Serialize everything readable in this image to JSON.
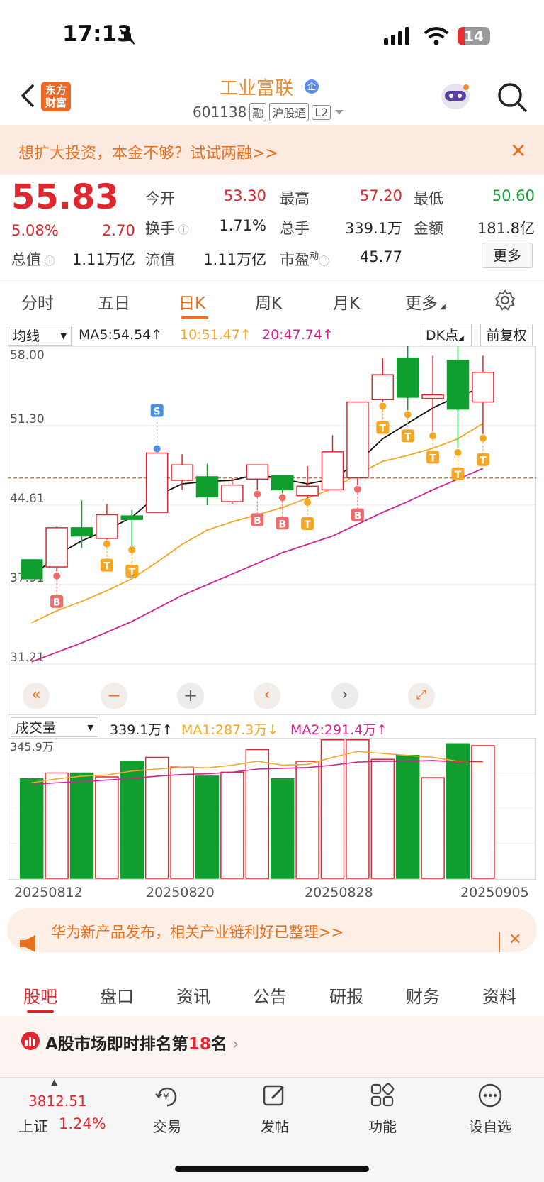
{
  "status_bar": {
    "time": "17:13",
    "battery": "14"
  },
  "header": {
    "logo_line1": "东方",
    "logo_line2": "财富",
    "stock_name": "工业富联",
    "name_badge": "企",
    "stock_code": "601138",
    "tags": [
      "融",
      "沪股通",
      "L2"
    ]
  },
  "promo": {
    "text": "想扩大投资，本金不够？试试两融>>"
  },
  "quote": {
    "price": "55.83",
    "change_pct": "5.08%",
    "change": "2.70",
    "market_cap_label": "总值",
    "market_cap": "1.11万亿",
    "rows": [
      [
        {
          "l": "今开",
          "v": "53.30",
          "c": "red"
        },
        {
          "l": "最高",
          "v": "57.20",
          "c": "red"
        },
        {
          "l": "最低",
          "v": "50.60",
          "c": "green"
        }
      ],
      [
        {
          "l": "换手",
          "v": "1.71%",
          "c": "dark"
        },
        {
          "l": "总手",
          "v": "339.1万",
          "c": "dark"
        },
        {
          "l": "金额",
          "v": "181.8亿",
          "c": "dark"
        }
      ],
      [
        {
          "l": "流值",
          "v": "1.11万亿",
          "c": "dark"
        },
        {
          "l": "市盈",
          "v": "45.77",
          "c": "dark"
        }
      ]
    ],
    "pe_sup": "动",
    "more": "更多"
  },
  "period_tabs": [
    "分时",
    "五日",
    "日K",
    "周K",
    "月K",
    "更多"
  ],
  "active_period": "日K",
  "chart_header": {
    "indicator": "均线",
    "ma5": "MA5:54.54↑",
    "ma10": "10:51.47↑",
    "ma20": "20:47.74↑",
    "dk": "DK点",
    "adjust": "前复权"
  },
  "colors": {
    "up": "#e0272f",
    "down": "#109f2f",
    "ma5": "#111111",
    "ma10": "#f5a623",
    "ma20": "#d6208f",
    "accent": "#e8701f"
  },
  "chart_data": {
    "type": "candlestick",
    "y_ticks": [
      "58.00",
      "51.30",
      "44.61",
      "37.91",
      "31.21"
    ],
    "ylim": [
      31.21,
      58.0
    ],
    "x_labels": [
      "20250812",
      "20250820",
      "20250828",
      "20250905"
    ],
    "candles": [
      {
        "o": 40.0,
        "c": 38.4,
        "h": 40.0,
        "l": 38.4,
        "up": false
      },
      {
        "o": 39.4,
        "c": 42.7,
        "h": 42.8,
        "l": 39.0,
        "up": true
      },
      {
        "o": 42.7,
        "c": 42.0,
        "h": 45.0,
        "l": 41.0,
        "up": false
      },
      {
        "o": 41.8,
        "c": 43.8,
        "h": 44.7,
        "l": 41.7,
        "up": true
      },
      {
        "o": 43.7,
        "c": 43.4,
        "h": 44.2,
        "l": 41.2,
        "up": false
      },
      {
        "o": 44.0,
        "c": 49.0,
        "h": 49.0,
        "l": 44.0,
        "up": true
      },
      {
        "o": 46.7,
        "c": 48.0,
        "h": 48.9,
        "l": 45.9,
        "up": true
      },
      {
        "o": 47.0,
        "c": 45.3,
        "h": 48.1,
        "l": 44.6,
        "up": false
      },
      {
        "o": 44.9,
        "c": 46.3,
        "h": 46.9,
        "l": 44.7,
        "up": true
      },
      {
        "o": 46.8,
        "c": 48.0,
        "h": 48.0,
        "l": 45.9,
        "up": true
      },
      {
        "o": 47.1,
        "c": 45.9,
        "h": 47.1,
        "l": 45.6,
        "up": false
      },
      {
        "o": 45.4,
        "c": 46.2,
        "h": 47.9,
        "l": 45.2,
        "up": true
      },
      {
        "o": 45.9,
        "c": 49.1,
        "h": 50.5,
        "l": 45.9,
        "up": true
      },
      {
        "o": 46.9,
        "c": 53.3,
        "h": 53.3,
        "l": 46.3,
        "up": true
      },
      {
        "o": 53.5,
        "c": 55.6,
        "h": 57.0,
        "l": 53.3,
        "up": true
      },
      {
        "o": 57.0,
        "c": 53.7,
        "h": 58.4,
        "l": 52.6,
        "up": false
      },
      {
        "o": 53.6,
        "c": 53.9,
        "h": 57.2,
        "l": 50.8,
        "up": true
      },
      {
        "o": 56.8,
        "c": 52.7,
        "h": 58.5,
        "l": 49.4,
        "up": false
      },
      {
        "o": 53.3,
        "c": 55.8,
        "h": 57.2,
        "l": 50.6,
        "up": true
      }
    ],
    "ma5": [
      38.5,
      40.4,
      41.6,
      42.5,
      43.6,
      45.4,
      46.4,
      46.6,
      46.7,
      47.2,
      46.8,
      46.4,
      46.8,
      48.2,
      50.2,
      51.5,
      52.8,
      53.8,
      54.5
    ],
    "ma10": [
      34.7,
      35.7,
      36.5,
      37.4,
      38.4,
      39.8,
      41.3,
      42.5,
      43.2,
      43.8,
      44.4,
      45.2,
      46.0,
      47.2,
      48.3,
      48.8,
      49.4,
      50.2,
      51.5
    ],
    "ma20": [
      31.4,
      32.2,
      33.0,
      33.9,
      34.8,
      35.9,
      37.0,
      37.9,
      38.8,
      39.7,
      40.6,
      41.3,
      42.0,
      43.0,
      44.0,
      44.9,
      45.9,
      46.8,
      47.7
    ],
    "signals": [
      {
        "i": 1,
        "t": "B"
      },
      {
        "i": 3,
        "t": "T"
      },
      {
        "i": 4,
        "t": "T"
      },
      {
        "i": 5,
        "t": "S"
      },
      {
        "i": 9,
        "t": "B"
      },
      {
        "i": 10,
        "t": "B"
      },
      {
        "i": 11,
        "t": "T"
      },
      {
        "i": 13,
        "t": "B"
      },
      {
        "i": 14,
        "t": "T"
      },
      {
        "i": 15,
        "t": "T"
      },
      {
        "i": 16,
        "t": "T"
      },
      {
        "i": 17,
        "t": "T"
      },
      {
        "i": 18,
        "t": "T"
      }
    ],
    "current_price_line": 46.9,
    "volume_header": {
      "selector": "成交量",
      "vol": "339.1万↑",
      "ma1": "MA1:287.3万↓",
      "ma2": "MA2:291.4万↑"
    },
    "volume_max_label": "345.9万",
    "volume": [
      255,
      270,
      270,
      260,
      300,
      310,
      285,
      262,
      272,
      330,
      255,
      300,
      355,
      355,
      305,
      315,
      258,
      345,
      340
    ],
    "vol_ma1": [
      245,
      255,
      262,
      265,
      275,
      280,
      285,
      283,
      290,
      300,
      290,
      292,
      310,
      325,
      320,
      315,
      310,
      300,
      298
    ],
    "vol_ma2": [
      240,
      245,
      248,
      252,
      256,
      262,
      266,
      268,
      272,
      280,
      282,
      284,
      290,
      298,
      300,
      300,
      302,
      298,
      300
    ]
  },
  "news": {
    "text": "华为新产品发布，相关产业链利好已整理>>"
  },
  "bottom_tabs": [
    "股吧",
    "盘口",
    "资讯",
    "公告",
    "研报",
    "财务",
    "资料"
  ],
  "rank": {
    "prefix": "A股市场即时排名第",
    "rank": "18",
    "suffix": "名"
  },
  "bottom_nav": {
    "index_value": "3812.51",
    "index_name": "上证",
    "index_pct": "1.24%",
    "items": [
      "交易",
      "发帖",
      "功能",
      "设自选"
    ]
  }
}
